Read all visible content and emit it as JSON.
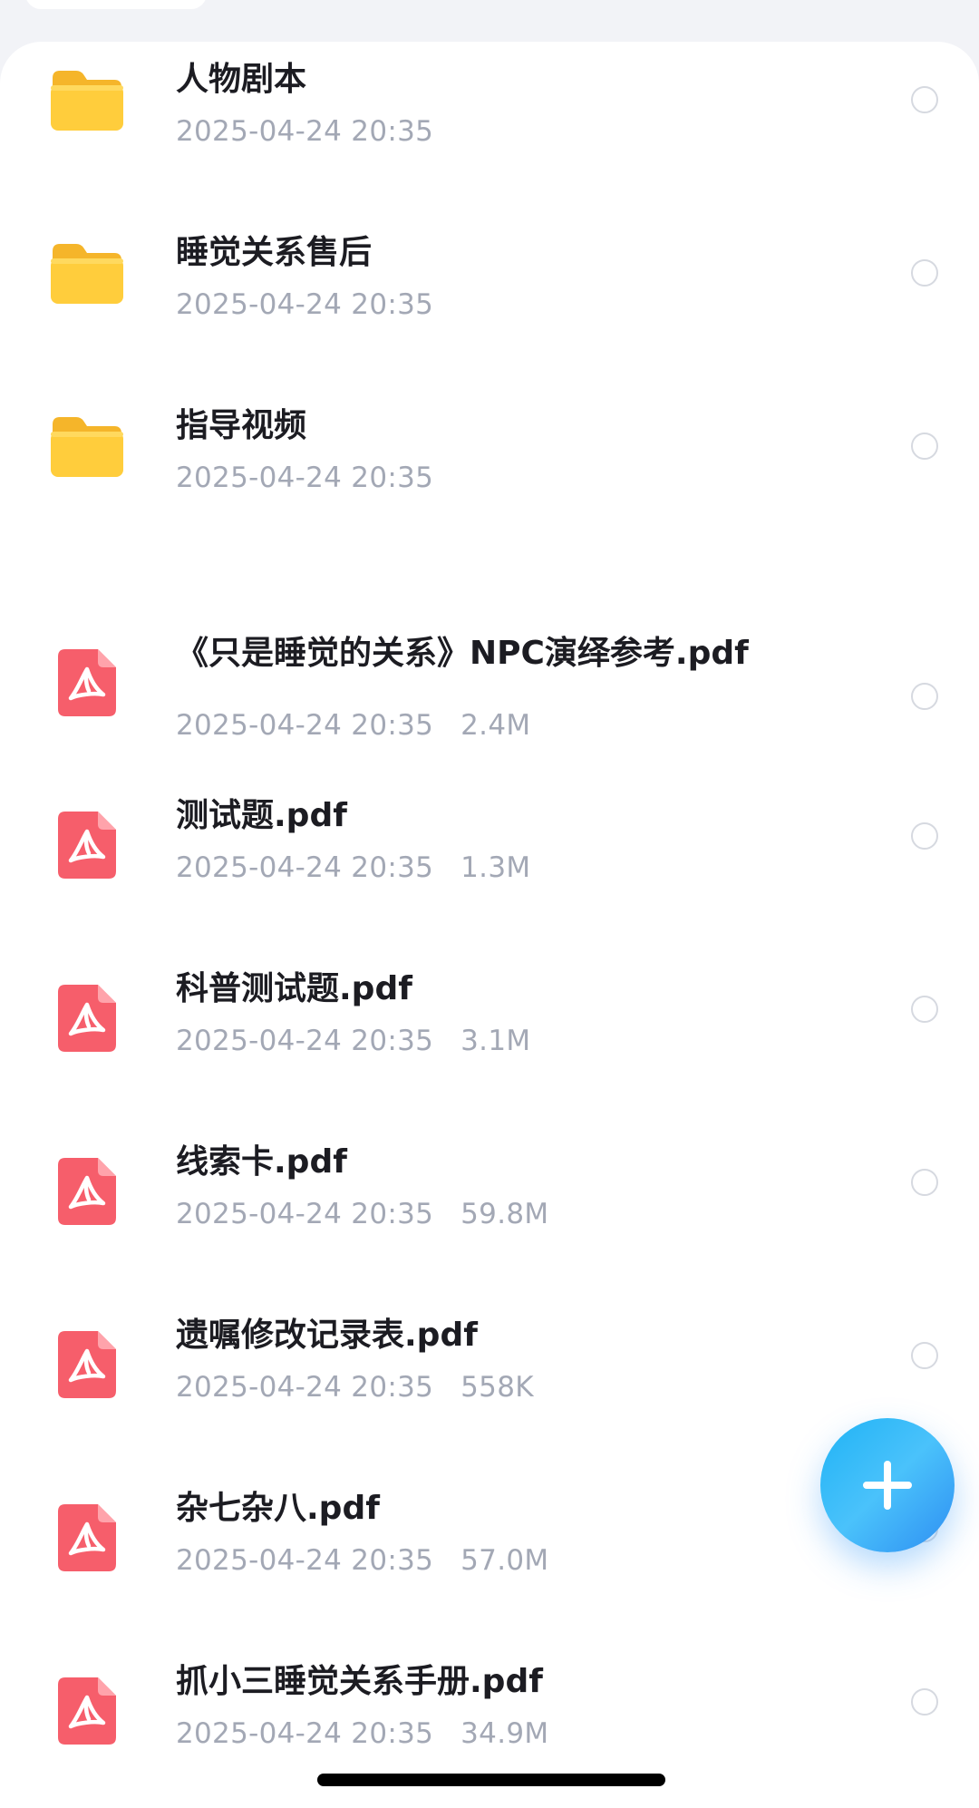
{
  "files": [
    {
      "name": "人物剧本",
      "date": "2025-04-24 20:35",
      "size": "",
      "type": "folder"
    },
    {
      "name": "睡觉关系售后",
      "date": "2025-04-24 20:35",
      "size": "",
      "type": "folder"
    },
    {
      "name": "指导视频",
      "date": "2025-04-24 20:35",
      "size": "",
      "type": "folder"
    },
    {
      "name": "《只是睡觉的关系》NPC演绎参考.pdf",
      "date": "2025-04-24 20:35",
      "size": "2.4M",
      "type": "pdf"
    },
    {
      "name": "测试题.pdf",
      "date": "2025-04-24 20:35",
      "size": "1.3M",
      "type": "pdf"
    },
    {
      "name": "科普测试题.pdf",
      "date": "2025-04-24 20:35",
      "size": "3.1M",
      "type": "pdf"
    },
    {
      "name": "线索卡.pdf",
      "date": "2025-04-24 20:35",
      "size": "59.8M",
      "type": "pdf"
    },
    {
      "name": "遗嘱修改记录表.pdf",
      "date": "2025-04-24 20:35",
      "size": "558K",
      "type": "pdf"
    },
    {
      "name": "杂七杂八.pdf",
      "date": "2025-04-24 20:35",
      "size": "57.0M",
      "type": "pdf"
    },
    {
      "name": "抓小三睡觉关系手册.pdf",
      "date": "2025-04-24 20:35",
      "size": "34.9M",
      "type": "pdf"
    }
  ],
  "icons": {
    "folder": "folder-icon",
    "pdf": "pdf-file-icon",
    "add": "plus-icon",
    "select": "radio-unchecked-icon"
  },
  "colors": {
    "folder": "#FFC93A",
    "pdf": "#F65E6B",
    "accent": "#2AA9F5",
    "meta_text": "#A3A8B5",
    "title_text": "#1C1C22"
  }
}
